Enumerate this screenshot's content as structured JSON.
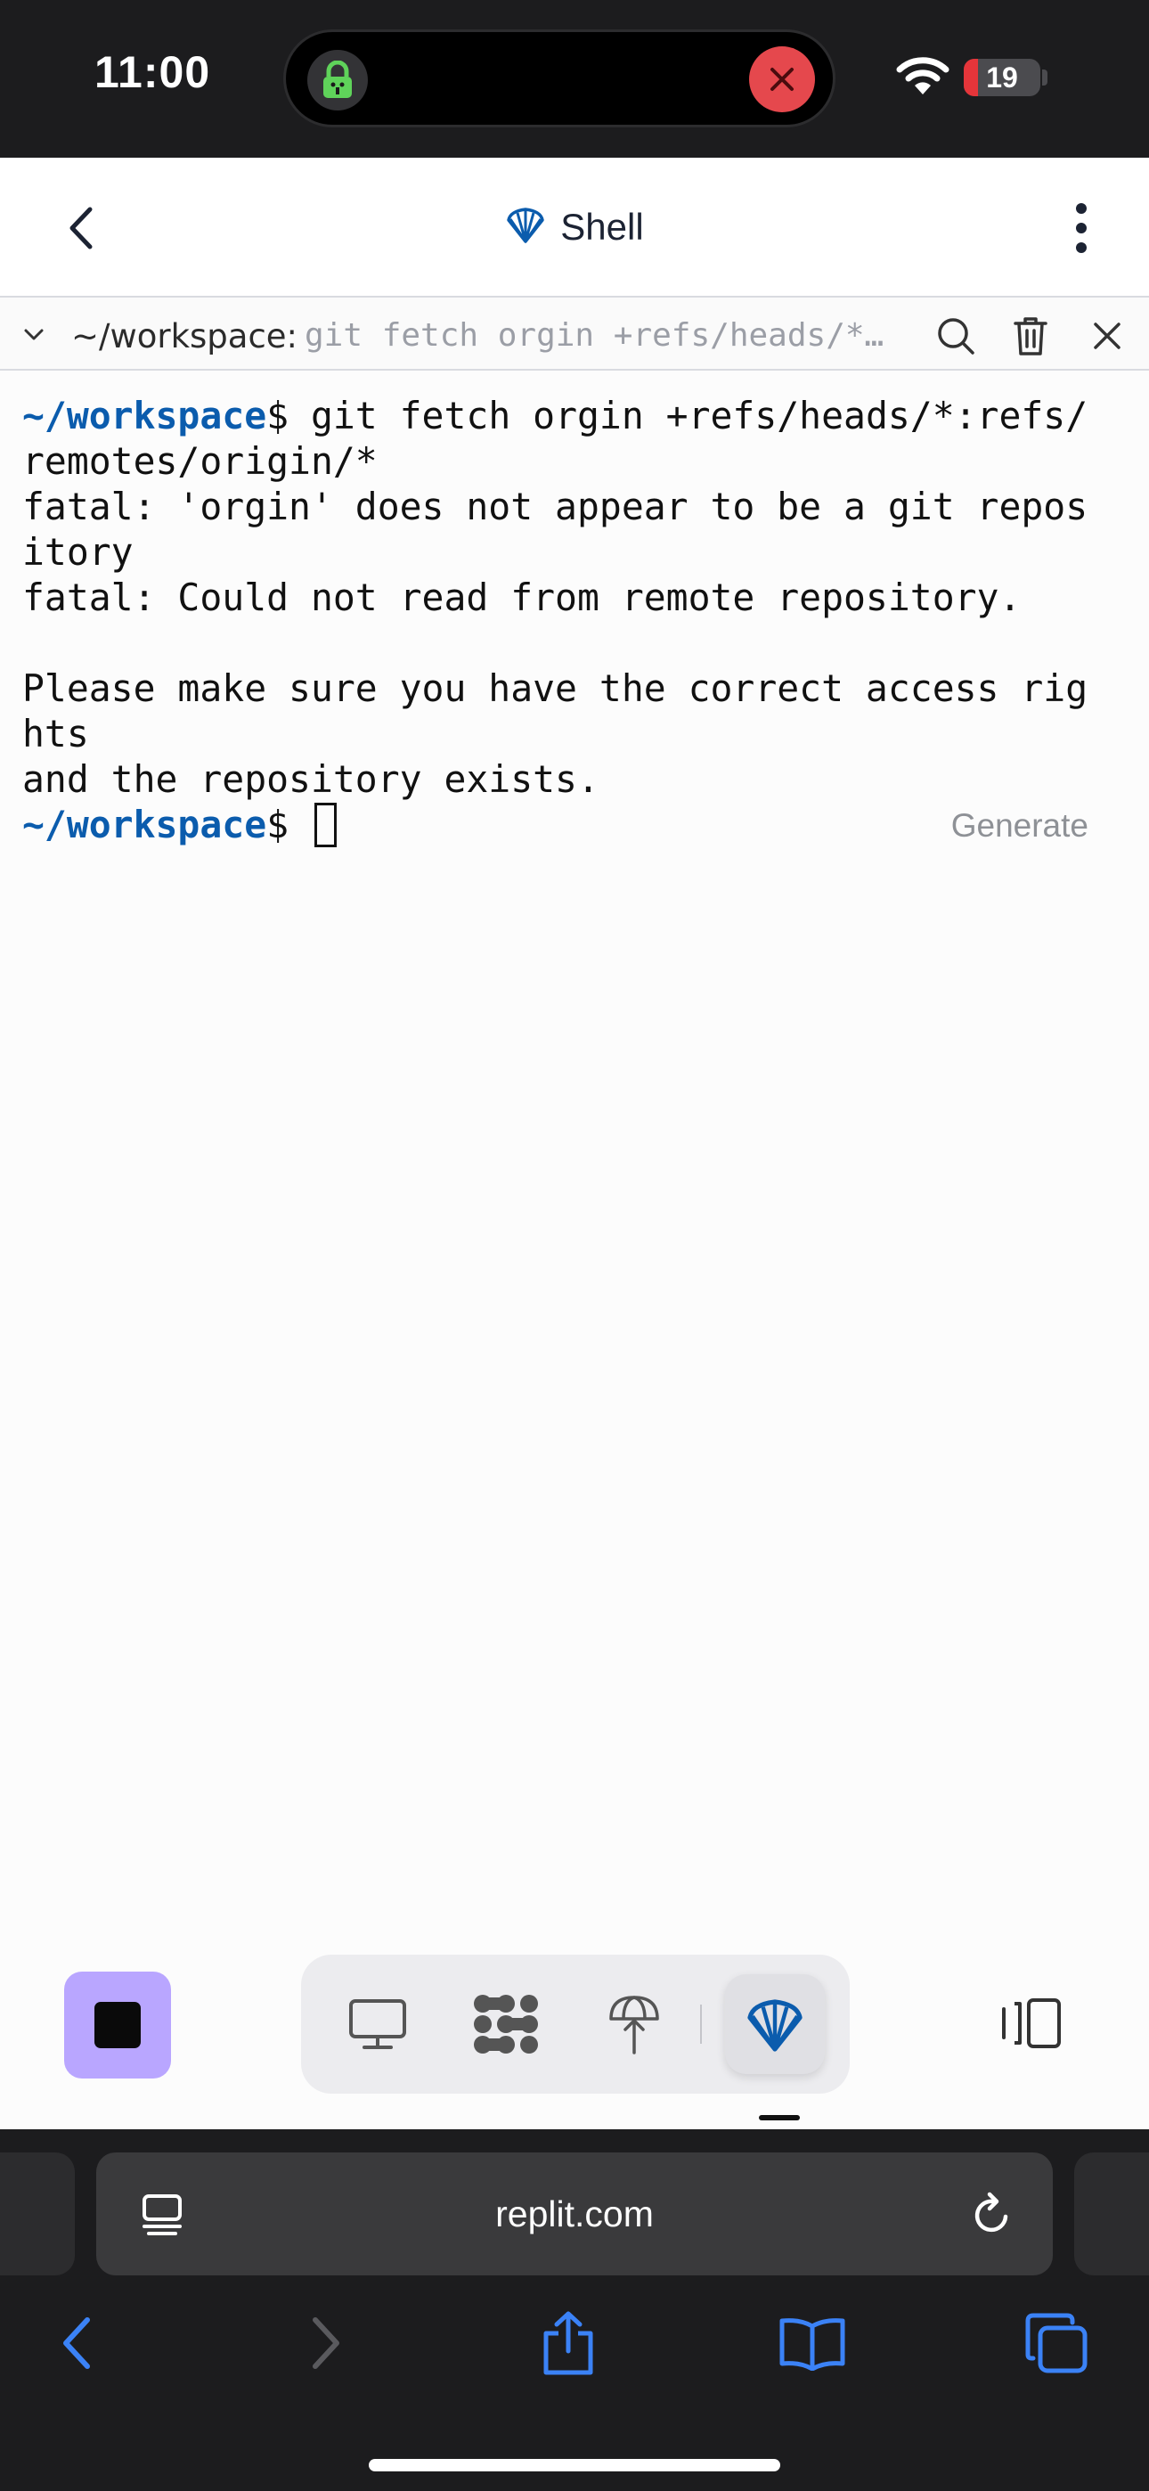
{
  "status_bar": {
    "time": "11:00",
    "battery_level": "19",
    "battery_fraction": 0.19
  },
  "header": {
    "title": "Shell",
    "icon": "shell-icon"
  },
  "toolbar": {
    "cwd": "~/workspace:",
    "command_preview": "git fetch orgin +refs/heads/*:refs/remotes/origin/*"
  },
  "terminal": {
    "prompt": "~/workspace",
    "lines": [
      {
        "prompt": "~/workspace",
        "text": "$ git fetch orgin +refs/heads/*:refs/"
      },
      {
        "text": "remotes/origin/*"
      },
      {
        "text": "fatal: 'orgin' does not appear to be a git repos"
      },
      {
        "text": "itory"
      },
      {
        "text": "fatal: Could not read from remote repository."
      },
      {
        "text": ""
      },
      {
        "text": "Please make sure you have the correct access rig"
      },
      {
        "text": "hts"
      },
      {
        "text": "and the repository exists."
      }
    ],
    "current_prompt_suffix": "$ ",
    "generate_label": "Generate"
  },
  "dock": {
    "items": [
      {
        "name": "webview",
        "icon": "monitor-icon"
      },
      {
        "name": "workflows",
        "icon": "replit-logo-icon"
      },
      {
        "name": "deploy",
        "icon": "deployments-icon"
      },
      {
        "name": "shell",
        "icon": "shell-icon",
        "active": true
      }
    ],
    "accent": "#b9a6ff"
  },
  "browser": {
    "url": "replit.com"
  }
}
